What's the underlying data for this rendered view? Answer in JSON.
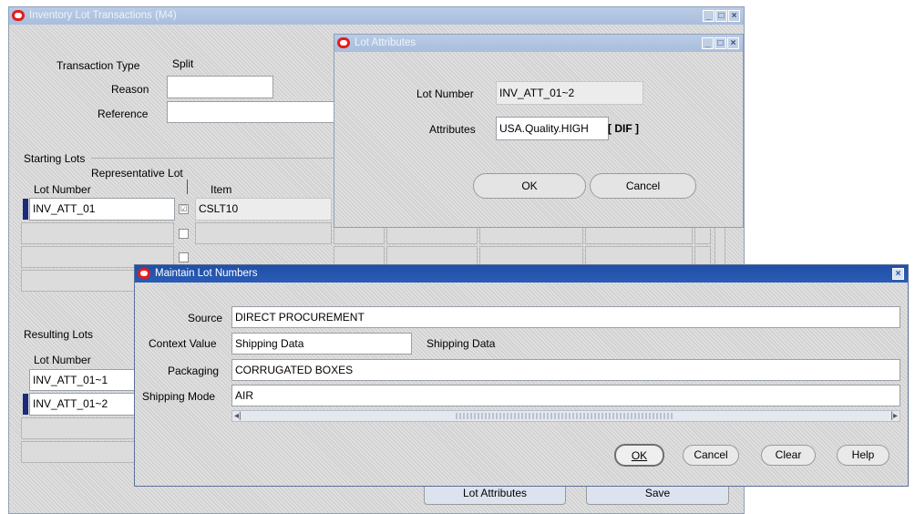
{
  "main_window": {
    "title": "Inventory Lot Transactions (M4)",
    "transaction_type_label": "Transaction Type",
    "transaction_type_value": "Split",
    "reason_label": "Reason",
    "reason_value": "",
    "reference_label": "Reference",
    "reference_value": "",
    "starting_lots_heading": "Starting Lots",
    "representative_lot_label": "Representative Lot",
    "lot_number_header": "Lot Number",
    "item_header": "Item",
    "starting_rows": [
      {
        "lot": "INV_ATT_01",
        "rep": true,
        "item": "CSLT10"
      },
      {
        "lot": "",
        "rep": false,
        "item": ""
      },
      {
        "lot": "",
        "rep": false,
        "item": ""
      },
      {
        "lot": "",
        "rep": false,
        "item": ""
      }
    ],
    "resulting_lots_heading": "Resulting Lots",
    "resulting_lot_number_header": "Lot Number",
    "resulting_rows": [
      {
        "lot": "INV_ATT_01~1"
      },
      {
        "lot": "INV_ATT_01~2"
      },
      {
        "lot": ""
      },
      {
        "lot": ""
      }
    ],
    "lot_attributes_button": "Lot Attributes",
    "save_button": "Save"
  },
  "lot_attributes_dialog": {
    "title": "Lot Attributes",
    "lot_number_label": "Lot Number",
    "lot_number_value": "INV_ATT_01~2",
    "attributes_label": "Attributes",
    "attributes_value": "USA.Quality.HIGH",
    "attributes_flex_value": "DIF",
    "ok_button": "OK",
    "cancel_button": "Cancel"
  },
  "maintain_dialog": {
    "title": "Maintain Lot Numbers",
    "source_label": "Source",
    "source_value": "DIRECT PROCUREMENT",
    "context_label": "Context Value",
    "context_value": "Shipping Data",
    "context_description": "Shipping Data",
    "packaging_label": "Packaging",
    "packaging_value": "CORRUGATED BOXES",
    "shipping_mode_label": "Shipping Mode",
    "shipping_mode_value": "AIR",
    "ok_button": "OK",
    "cancel_button": "Cancel",
    "clear_button": "Clear",
    "help_button": "Help"
  },
  "colors": {
    "titlebar_active": "#1f4fa6",
    "titlebar_inactive": "#a9bedd",
    "oracle_icon": "#e31d1d",
    "current_record_marker": "#1b2a7a"
  }
}
